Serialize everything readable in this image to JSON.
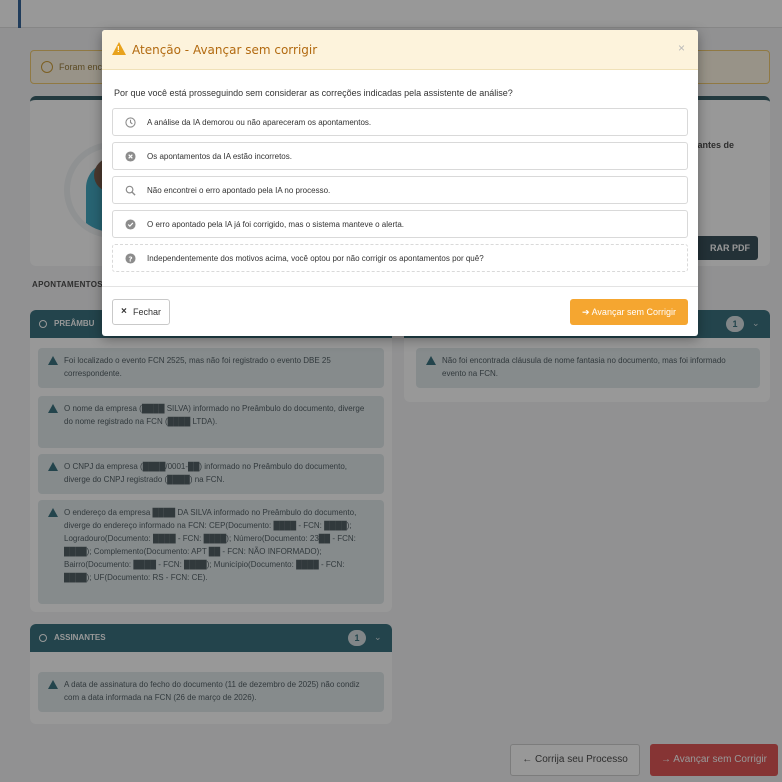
{
  "background": {
    "alert_text": "Foram enc",
    "side_text": "s antes de",
    "pdf_button": "RAR PDF",
    "section_title": "APONTAMENTOS",
    "panels": {
      "preambulo": {
        "title": "PREÂMBU",
        "items": [
          "Foi localizado o evento FCN 2525, mas não foi registrado o evento DBE 25 correspondente.",
          "O nome da empresa (████ SILVA) informado no Preâmbulo do documento, diverge do nome registrado na FCN (████ LTDA).",
          "O CNPJ da empresa (████/0001-██) informado no Preâmbulo do documento, diverge do CNPJ registrado (████) na FCN.",
          "O endereço da empresa ████ DA SILVA informado no Preâmbulo do documento, diverge do endereço informado na FCN: CEP(Documento: ████ - FCN: ████); Logradouro(Documento: ████ - FCN: ████); Número(Documento: 23██ - FCN: ████); Complemento(Documento: APT ██ - FCN: NÃO INFORMADO); Bairro(Documento: ████ - FCN: ████); Município(Documento: ████ - FCN: ████); UF(Documento: RS - FCN: CE)."
        ]
      },
      "assinantes": {
        "title": "ASSINANTES",
        "count": "1",
        "items": [
          "A data de assinatura do fecho do documento (11 de dezembro de 2025) não condiz com a data informada na FCN (26 de março de 2026)."
        ]
      },
      "right": {
        "count": "1",
        "items": [
          "Não foi encontrada cláusula de nome fantasia no documento, mas foi informado evento na FCN."
        ]
      }
    },
    "bottom": {
      "back_label": "← Corrija seu Processo",
      "advance_label": "→ Avançar sem Corrigir"
    }
  },
  "modal": {
    "title": "Atenção - Avançar sem corrigir",
    "close": "×",
    "question": "Por que você está prosseguindo sem considerar as correções indicadas pela assistente de análise?",
    "options": [
      {
        "icon": "clock-icon",
        "label": "A análise da IA demorou ou não apareceram os apontamentos."
      },
      {
        "icon": "x-circle-icon",
        "label": "Os apontamentos da IA estão incorretos."
      },
      {
        "icon": "search-icon",
        "label": "Não encontrei o erro apontado pela IA no processo."
      },
      {
        "icon": "check-circle-icon",
        "label": "O erro apontado pela IA já foi corrigido, mas o sistema manteve o alerta."
      },
      {
        "icon": "question-circle-icon",
        "label": "Independentemente dos motivos acima, você optou por não corrigir os apontamentos por quê?"
      }
    ],
    "close_button": "Fechar",
    "advance_button": "Avançar sem Corrigir"
  },
  "colors": {
    "teal": "#1f5f6e",
    "orange": "#f5a630",
    "red": "#dc4040",
    "warning_header": "#fdf3dc"
  }
}
